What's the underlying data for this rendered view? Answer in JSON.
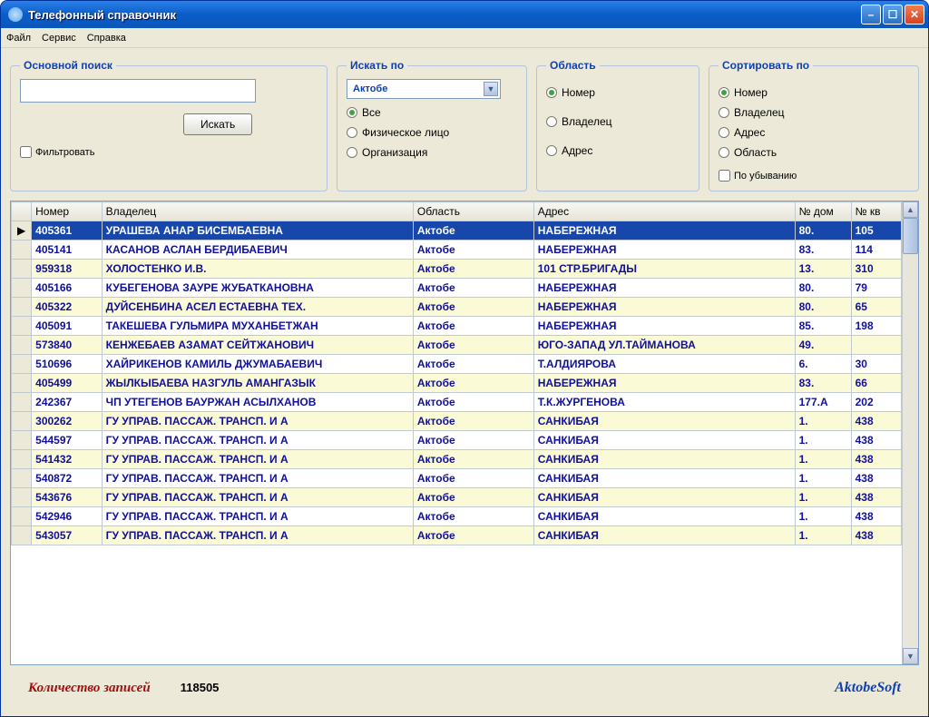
{
  "window": {
    "title": "Телефонный справочник"
  },
  "menu": {
    "file": "Файл",
    "service": "Сервис",
    "help": "Справка"
  },
  "groups": {
    "search": {
      "legend": "Основной поиск",
      "button": "Искать",
      "filter": "Фильтровать"
    },
    "searchby": {
      "legend": "Искать по",
      "combo": "Актобе",
      "all": "Все",
      "person": "Физическое лицо",
      "org": "Организация"
    },
    "region": {
      "legend": "Область",
      "number": "Номер",
      "owner": "Владелец",
      "address": "Адрес"
    },
    "sort": {
      "legend": "Сортировать по",
      "number": "Номер",
      "owner": "Владелец",
      "address": "Адрес",
      "region": "Область",
      "desc": "По убыванию"
    }
  },
  "columns": {
    "number": "Номер",
    "owner": "Владелец",
    "region": "Область",
    "address": "Адрес",
    "house": "№ дом",
    "apt": "№ кв"
  },
  "rows": [
    {
      "num": "405361",
      "owner": "УРАШЕВА АНАР БИСЕМБАЕВНА",
      "region": "Актобе",
      "addr": "НАБЕРЕЖНАЯ",
      "house": "80.",
      "apt": "105"
    },
    {
      "num": "405141",
      "owner": "КАСАНОВ АСЛАН БЕРДИБАЕВИЧ",
      "region": "Актобе",
      "addr": "НАБЕРЕЖНАЯ",
      "house": "83.",
      "apt": "114"
    },
    {
      "num": "959318",
      "owner": "ХОЛОСТЕНКО И.В.",
      "region": "Актобе",
      "addr": "101 СТР.БРИГАДЫ",
      "house": "13.",
      "apt": "310"
    },
    {
      "num": "405166",
      "owner": "КУБЕГЕНОВА ЗАУРЕ ЖУБАТКАНОВНА",
      "region": "Актобе",
      "addr": "НАБЕРЕЖНАЯ",
      "house": "80.",
      "apt": "79"
    },
    {
      "num": "405322",
      "owner": "ДУЙСЕНБИНА АСЕЛ ЕСТАЕВНА ТЕХ.",
      "region": "Актобе",
      "addr": "НАБЕРЕЖНАЯ",
      "house": "80.",
      "apt": "65"
    },
    {
      "num": "405091",
      "owner": "ТАКЕШЕВА ГУЛЬМИРА МУХАНБЕТЖАН",
      "region": "Актобе",
      "addr": "НАБЕРЕЖНАЯ",
      "house": "85.",
      "apt": "198"
    },
    {
      "num": "573840",
      "owner": "КЕНЖЕБАЕВ АЗАМАТ СЕЙТЖАНОВИЧ",
      "region": "Актобе",
      "addr": "ЮГО-ЗАПАД УЛ.ТАЙМАНОВА",
      "house": "49.",
      "apt": ""
    },
    {
      "num": "510696",
      "owner": "ХАЙРИКЕНОВ КАМИЛЬ ДЖУМАБАЕВИЧ",
      "region": "Актобе",
      "addr": "Т.АЛДИЯРОВА",
      "house": "6.",
      "apt": "30"
    },
    {
      "num": "405499",
      "owner": "ЖЫЛКЫБАЕВА НАЗГУЛЬ АМАНГАЗЫК",
      "region": "Актобе",
      "addr": "НАБЕРЕЖНАЯ",
      "house": "83.",
      "apt": "66"
    },
    {
      "num": "242367",
      "owner": "ЧП УТЕГЕНОВ БАУРЖАН АСЫЛХАНОВ",
      "region": "Актобе",
      "addr": "Т.К.ЖУРГЕНОВА",
      "house": "177.А",
      "apt": "202"
    },
    {
      "num": "300262",
      "owner": "ГУ  УПРАВ. ПАССАЖ. ТРАНСП. И А",
      "region": "Актобе",
      "addr": "САНКИБАЯ",
      "house": "1.",
      "apt": "438"
    },
    {
      "num": "544597",
      "owner": "ГУ  УПРАВ. ПАССАЖ. ТРАНСП. И А",
      "region": "Актобе",
      "addr": "САНКИБАЯ",
      "house": "1.",
      "apt": "438"
    },
    {
      "num": "541432",
      "owner": "ГУ  УПРАВ. ПАССАЖ. ТРАНСП. И А",
      "region": "Актобе",
      "addr": "САНКИБАЯ",
      "house": "1.",
      "apt": "438"
    },
    {
      "num": "540872",
      "owner": "ГУ  УПРАВ. ПАССАЖ. ТРАНСП. И А",
      "region": "Актобе",
      "addr": "САНКИБАЯ",
      "house": "1.",
      "apt": "438"
    },
    {
      "num": "543676",
      "owner": "ГУ  УПРАВ. ПАССАЖ. ТРАНСП. И А",
      "region": "Актобе",
      "addr": "САНКИБАЯ",
      "house": "1.",
      "apt": "438"
    },
    {
      "num": "542946",
      "owner": "ГУ  УПРАВ. ПАССАЖ. ТРАНСП. И А",
      "region": "Актобе",
      "addr": "САНКИБАЯ",
      "house": "1.",
      "apt": "438"
    },
    {
      "num": "543057",
      "owner": "ГУ  УПРАВ. ПАССАЖ. ТРАНСП. И А",
      "region": "Актобе",
      "addr": "САНКИБАЯ",
      "house": "1.",
      "apt": "438"
    }
  ],
  "footer": {
    "count_label": "Количество записей",
    "count": "118505",
    "brand": "AktobeSoft"
  }
}
